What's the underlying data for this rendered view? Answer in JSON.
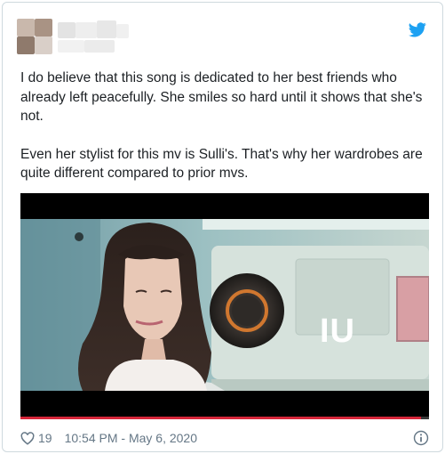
{
  "tweet": {
    "paragraphs": [
      "I do believe that this song is dedicated to her best friends who already left peacefully. She smiles so hard until it shows that she's not.",
      "Even her stylist for this mv is Sulli's. That's why her wardrobes are quite different compared to prior mvs."
    ],
    "likes": "19",
    "timestamp": "10:54 PM - May 6, 2020"
  },
  "media": {
    "overlay_text": "IU",
    "progress": 0.98,
    "colors": {
      "progress": "#d6263a",
      "letterbox": "#000000"
    }
  },
  "icons": {
    "brand": "twitter-bird-icon",
    "like": "heart-icon",
    "info": "info-icon"
  },
  "colors": {
    "twitter_blue": "#1da1f2",
    "meta_text": "#657786",
    "border": "#cfd9de"
  }
}
